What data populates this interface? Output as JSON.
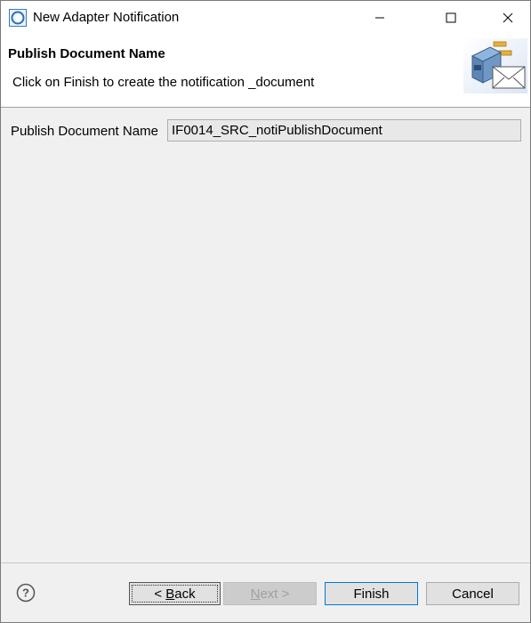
{
  "window": {
    "title": "New Adapter Notification",
    "icon": "eclipse-app-icon"
  },
  "banner": {
    "title": "Publish Document Name",
    "description": "Click on Finish to create the notification _document",
    "image": "adapter-notification-wizard-icon"
  },
  "form": {
    "publish_document_label": "Publish Document Name",
    "publish_document_value": "IF0014_SRC_notiPublishDocument"
  },
  "footer": {
    "back_mnemonic": "B",
    "back_rest": "ack",
    "back_prefix": "< ",
    "next_mnemonic": "N",
    "next_rest": "ext >",
    "finish_label": "Finish",
    "cancel_label": "Cancel"
  }
}
